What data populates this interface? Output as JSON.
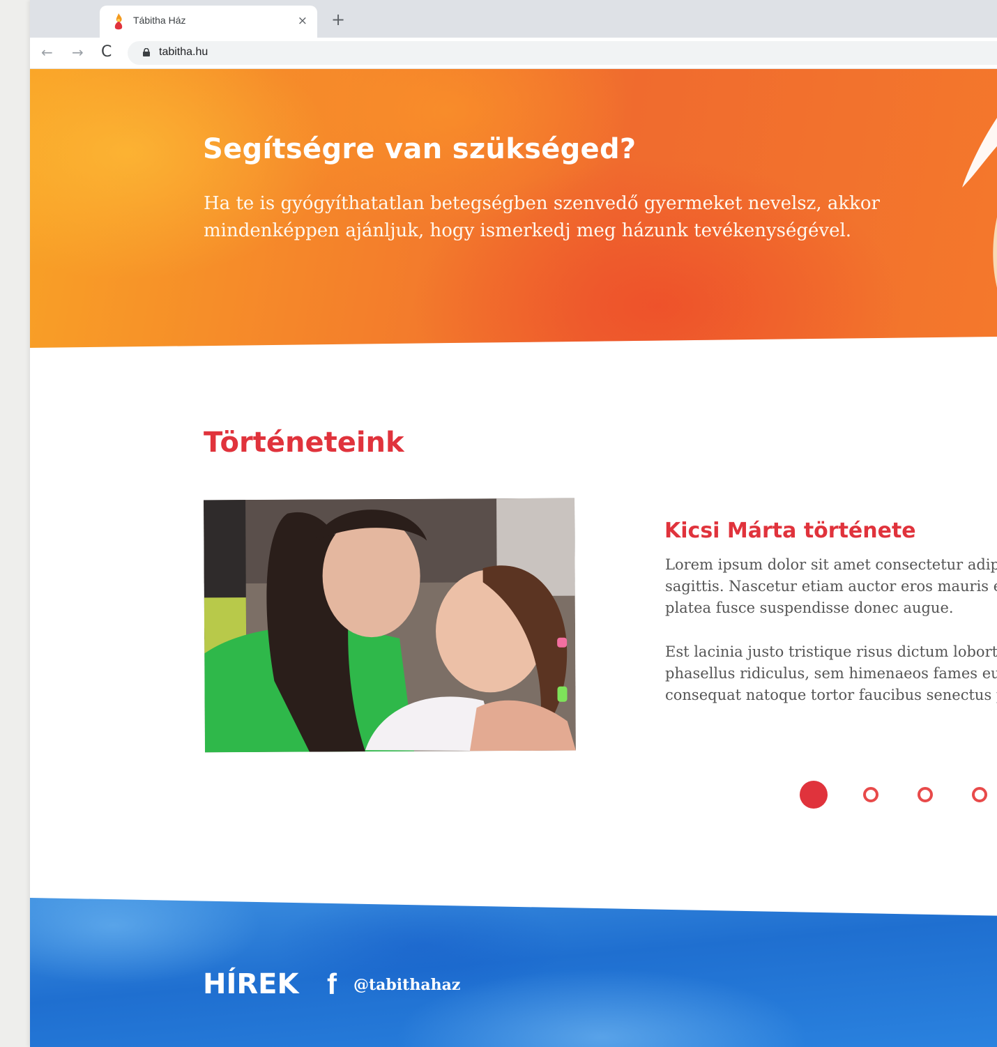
{
  "browser": {
    "tab_title": "Tábitha Ház",
    "close_symbol": "×",
    "new_tab_symbol": "+",
    "back_symbol": "←",
    "forward_symbol": "→",
    "reload_symbol": "C",
    "url": "tabitha.hu"
  },
  "hero": {
    "title": "Segítségre van szükséged?",
    "text": "Ha te is gyógyíthatatlan betegségben szenvedő gyermeket nevelsz, akkor mindenképpen ajánljuk, hogy ismerkedj meg házunk tevékenységével."
  },
  "stories": {
    "title": "Történeteink",
    "story_name": "Kicsi Márta története",
    "paragraph1_lines": [
      "Lorem ipsum dolor sit amet consectetur adip",
      "sagittis. Nascetur etiam auctor eros mauris e",
      "platea fusce suspendisse donec augue."
    ],
    "paragraph2_lines": [
      "Est lacinia justo tristique risus dictum lobort",
      "phasellus ridiculus, sem himenaeos fames eu",
      "consequat natoque tortor faucibus senectus p"
    ],
    "pagination": {
      "total_visible": 4,
      "active_index": 0
    }
  },
  "news": {
    "title": "HÍREK",
    "facebook_icon": "f",
    "facebook_handle": "@tabithahaz"
  },
  "colors": {
    "accent_red": "#e0333c",
    "hero_orange": "#f5862a",
    "news_blue": "#1f6fd0"
  },
  "icons": {
    "favicon": "tabitha-flame-logo",
    "lock": "lock-icon",
    "facebook": "facebook-icon"
  }
}
